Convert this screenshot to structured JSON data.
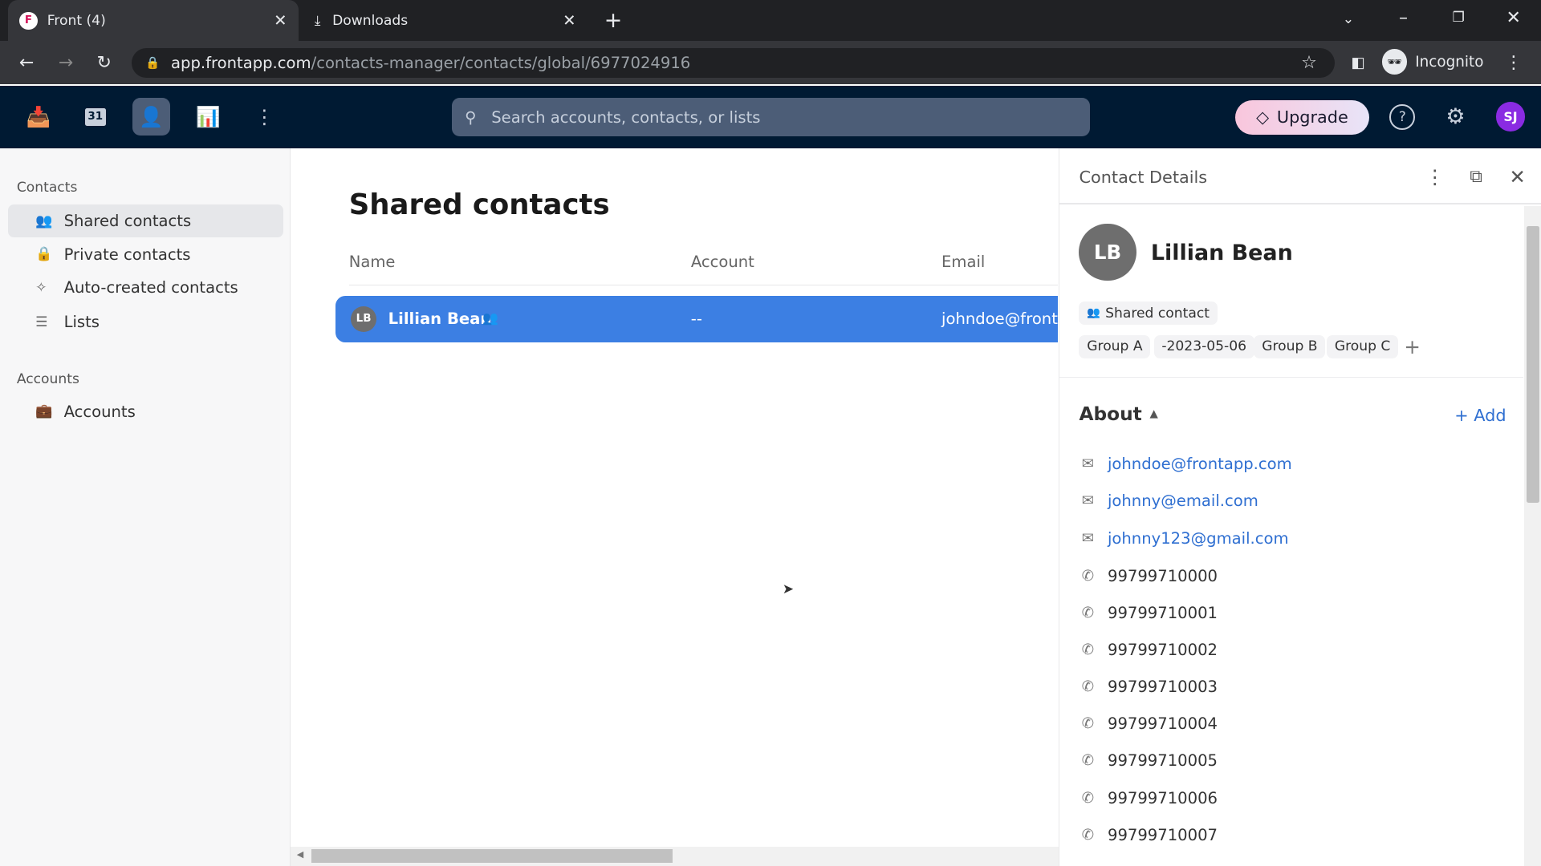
{
  "browser": {
    "tabs": [
      {
        "title": "Front (4)",
        "icon": "front-logo-icon"
      },
      {
        "title": "Downloads",
        "icon": "download-icon"
      }
    ],
    "url_host": "app.frontapp.com",
    "url_path": "/contacts-manager/contacts/global/6977024916",
    "profile": "Incognito"
  },
  "app": {
    "search_placeholder": "Search accounts, contacts, or lists",
    "upgrade_label": "Upgrade",
    "avatar": "SJ",
    "calendar_day": "31"
  },
  "sidebar": {
    "contacts_heading": "Contacts",
    "items": [
      {
        "label": "Shared contacts",
        "icon": "shared-contacts-icon"
      },
      {
        "label": "Private contacts",
        "icon": "lock-icon"
      },
      {
        "label": "Auto-created contacts",
        "icon": "sparkle-icon"
      },
      {
        "label": "Lists",
        "icon": "list-icon"
      }
    ],
    "accounts_heading": "Accounts",
    "account_items": [
      {
        "label": "Accounts",
        "icon": "briefcase-icon"
      }
    ]
  },
  "main": {
    "title": "Shared contacts",
    "columns": [
      "Name",
      "Account",
      "Email"
    ],
    "rows": [
      {
        "initials": "LB",
        "name": "Lillian Bean",
        "account": "--",
        "email": "johndoe@front"
      }
    ]
  },
  "details": {
    "title": "Contact Details",
    "initials": "LB",
    "name": "Lillian Bean",
    "type_label": "Shared contact",
    "tags": [
      "Group A",
      "-2023-05-06",
      "Group B",
      "Group C"
    ],
    "about_label": "About",
    "add_label": "+ Add",
    "emails": [
      "johndoe@frontapp.com",
      "johnny@email.com",
      "johnny123@gmail.com"
    ],
    "phones": [
      "99799710000",
      "99799710001",
      "99799710002",
      "99799710003",
      "99799710004",
      "99799710005",
      "99799710006",
      "99799710007"
    ]
  },
  "colors": {
    "accent": "#3c7fe3",
    "header": "#001a33",
    "link": "#2f6fd1"
  }
}
